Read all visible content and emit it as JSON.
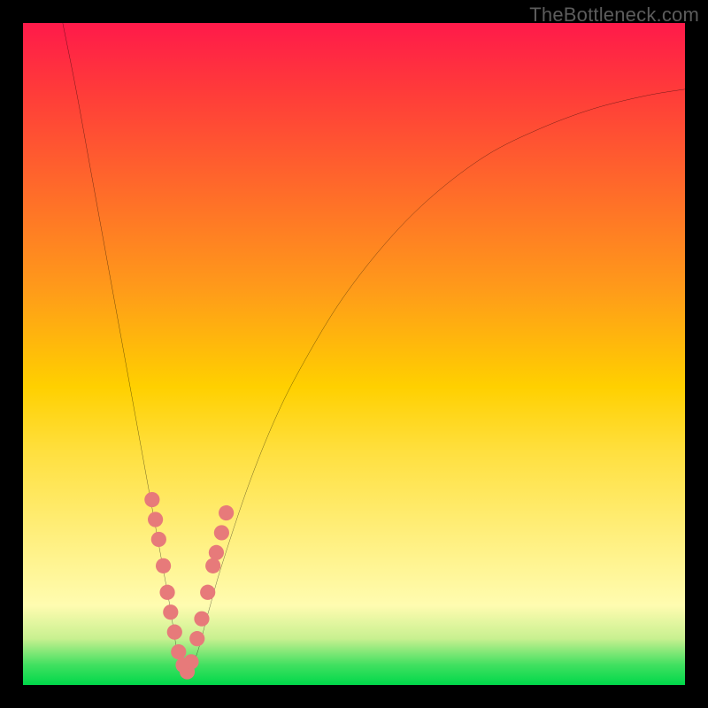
{
  "watermark": "TheBottleneck.com",
  "chart_data": {
    "type": "line",
    "title": "",
    "xlabel": "",
    "ylabel": "",
    "xlim": [
      0,
      100
    ],
    "ylim": [
      0,
      100
    ],
    "grid": false,
    "axes_visible": false,
    "description": "Bottleneck mismatch curve. The V-shaped black curve shows percentage mismatch across a component-pairing axis; the vertex (0% mismatch) sits near x≈24. Background color gradient encodes severity: red (top, high mismatch) → yellow → green (bottom, 0%). Salmon dots along the lower V are sampled hardware pairings near the optimum.",
    "series": [
      {
        "name": "mismatch-curve",
        "kind": "curve",
        "x": [
          6,
          8,
          10,
          12,
          14,
          16,
          18,
          20,
          22,
          24,
          26,
          28,
          30,
          34,
          38,
          42,
          48,
          55,
          62,
          70,
          78,
          86,
          94,
          100
        ],
        "values": [
          100,
          90,
          79,
          68,
          57,
          46,
          35,
          24,
          13,
          2,
          4,
          11,
          18,
          30,
          40,
          48,
          58,
          67,
          74,
          80,
          84,
          87,
          89,
          90
        ]
      },
      {
        "name": "sample-points",
        "kind": "scatter",
        "x": [
          19.5,
          20.0,
          20.5,
          21.2,
          21.8,
          22.3,
          22.9,
          23.5,
          24.2,
          24.8,
          25.4,
          26.3,
          27.0,
          27.9,
          28.7,
          29.2,
          30.0,
          30.7
        ],
        "values": [
          28.0,
          25.0,
          22.0,
          18.0,
          14.0,
          11.0,
          8.0,
          5.0,
          3.0,
          2.0,
          3.5,
          7.0,
          10.0,
          14.0,
          18.0,
          20.0,
          23.0,
          26.0
        ]
      }
    ],
    "colors": {
      "curve": "#000000",
      "points": "#e77a7a",
      "gradient_top": "#ff1a4a",
      "gradient_mid1": "#ff9a1a",
      "gradient_mid2": "#ffe040",
      "gradient_bottom": "#00d84a"
    }
  }
}
